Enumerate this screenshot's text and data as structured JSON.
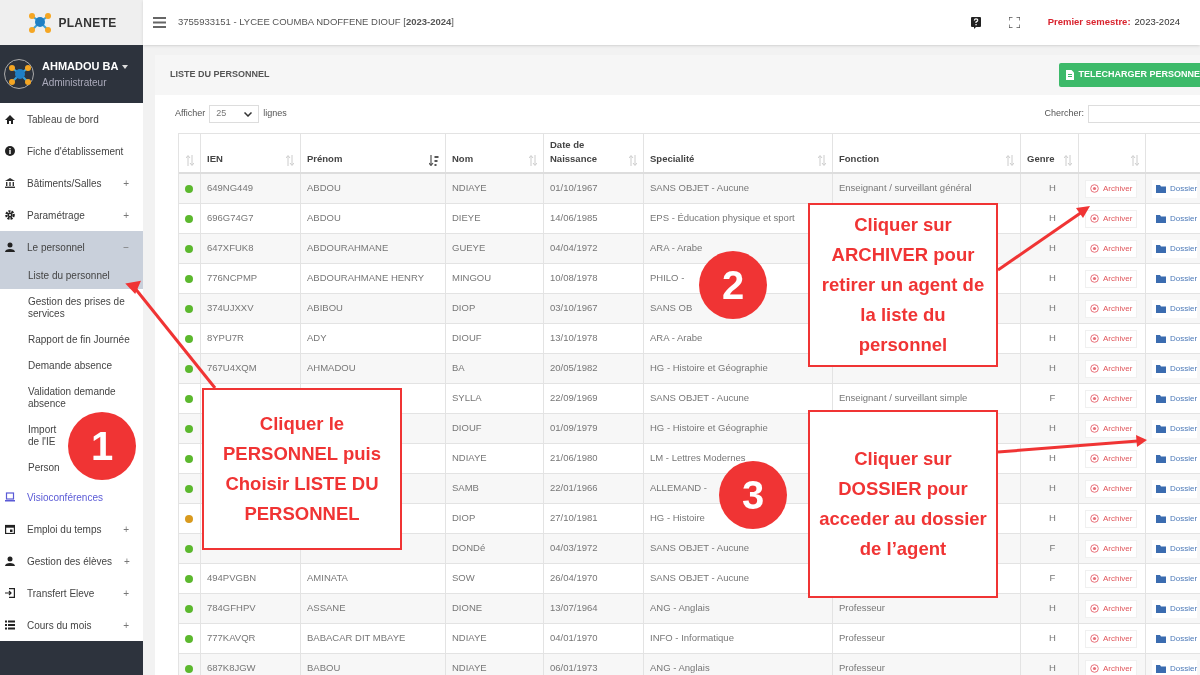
{
  "brand": {
    "name": "PLANETE"
  },
  "user": {
    "name": "AHMADOU BA",
    "role": "Administrateur"
  },
  "sidebar": {
    "items": [
      {
        "label": "Tableau de bord"
      },
      {
        "label": "Fiche d'établissement"
      },
      {
        "label": "Bâtiments/Salles",
        "toggle": "+"
      },
      {
        "label": "Paramétrage",
        "toggle": "+"
      },
      {
        "label": "Le personnel",
        "toggle": "−",
        "expanded": true,
        "children": [
          {
            "label": "Liste du personnel",
            "selected": true
          },
          {
            "label": "Gestion des prises de services",
            "selected": false
          },
          {
            "label": "Rapport de fin Journée",
            "selected": false
          },
          {
            "label": "Demande absence",
            "selected": false
          },
          {
            "label": "Validation demande absence",
            "selected": false
          },
          {
            "label": "Import de l'IE",
            "selected": false
          },
          {
            "label": "Person",
            "selected": false
          }
        ]
      },
      {
        "label": "Visioconférences",
        "kind": "link"
      },
      {
        "label": "Emploi du temps",
        "toggle": "+"
      },
      {
        "label": "Gestion des élèves",
        "toggle": "+"
      },
      {
        "label": "Transfert Eleve",
        "toggle": "+"
      },
      {
        "label": "Cours du mois",
        "toggle": "+"
      }
    ]
  },
  "header": {
    "title": "3755933151 - LYCEE COUMBA NDOFFENE DIOUF [**2023-2024**]",
    "semester_label": "Premier semestre:",
    "semester_value": "2023-2024"
  },
  "panel": {
    "title": "LISTE DU PERSONNEL",
    "download_button": "TELECHARGER PERSONNE",
    "show_label": "Afficher",
    "page_size": "25",
    "rows_label": "lignes",
    "search_label": "Chercher:"
  },
  "table": {
    "columns": [
      {
        "sorted": false
      },
      {
        "label": "IEN",
        "sorted": false
      },
      {
        "label": "Prénom",
        "sorted": true
      },
      {
        "label": "Nom",
        "sorted": false
      },
      {
        "label": "Date de Naissance",
        "sorted": false
      },
      {
        "label": "Specialité",
        "sorted": false
      },
      {
        "label": "Fonction",
        "sorted": false
      },
      {
        "label": "Genre",
        "sorted": false
      },
      {
        "sorted": false
      }
    ],
    "rows": [
      {
        "color": "#5cb82e",
        "ien": "649NG449",
        "prenom": "ABDOU",
        "nom": "NDIAYE",
        "date": "01/10/1967",
        "specialite": "SANS OBJET - Aucune",
        "fonction": "Enseignant / surveillant général",
        "genre": "H",
        "archive": "Archiver",
        "dossier": "Dossier"
      },
      {
        "color": "#5cb82e",
        "ien": "696G74G7",
        "prenom": "ABDOU",
        "nom": "DIEYE",
        "date": "14/06/1985",
        "specialite": "EPS - Éducation physique et sport",
        "genre": "H",
        "archive": "Archiver",
        "dossier": "Dossier"
      },
      {
        "color": "#5cb82e",
        "ien": "647XFUK8",
        "prenom": "ABDOURAHMANE",
        "nom": "GUEYE",
        "date": "04/04/1972",
        "specialite": "ARA - Arabe",
        "genre": "H",
        "archive": "Archiver",
        "dossier": "Dossier"
      },
      {
        "color": "#5cb82e",
        "ien": "776NCPMP",
        "prenom": "ABDOURAHMANE HENRY",
        "nom": "MINGOU",
        "date": "10/08/1978",
        "specialite": "PHILO -",
        "genre": "H",
        "archive": "Archiver",
        "dossier": "Dossier"
      },
      {
        "color": "#5cb82e",
        "ien": "374UJXXV",
        "prenom": "ABIBOU",
        "nom": "DIOP",
        "date": "03/10/1967",
        "specialite": "SANS OB",
        "genre": "H",
        "archive": "Archiver",
        "dossier": "Dossier"
      },
      {
        "color": "#5cb82e",
        "ien": "8YPU7R",
        "prenom": "ADY",
        "nom": "DIOUF",
        "date": "13/10/1978",
        "specialite": "ARA - Arabe",
        "genre": "H",
        "archive": "Archiver",
        "dossier": "Dossier"
      },
      {
        "color": "#5cb82e",
        "ien": "767U4XQM",
        "prenom": "AHMADOU",
        "nom": "BA",
        "date": "20/05/1982",
        "specialite": "HG - Histoire et Géographie",
        "genre": "H",
        "archive": "Archiver",
        "dossier": "Dossier"
      },
      {
        "color": "#5cb82e",
        "nom": "SYLLA",
        "date": "22/09/1969",
        "specialite": "SANS OBJET - Aucune",
        "fonction": "Enseignant / surveillant simple",
        "genre": "F",
        "archive": "Archiver",
        "dossier": "Dossier"
      },
      {
        "color": "#5cb82e",
        "nom": "DIOUF",
        "date": "01/09/1979",
        "specialite": "HG - Histoire et Géographie",
        "genre": "H",
        "archive": "Archiver",
        "dossier": "Dossier"
      },
      {
        "color": "#5cb82e",
        "nom": "NDIAYE",
        "date": "21/06/1980",
        "specialite": "LM - Lettres Modernes",
        "genre": "H",
        "archive": "Archiver",
        "dossier": "Dossier"
      },
      {
        "color": "#5cb82e",
        "nom": "SAMB",
        "date": "22/01/1966",
        "specialite": "ALLEMAND -",
        "genre": "H",
        "archive": "Archiver",
        "dossier": "Dossier"
      },
      {
        "color": "#d99a1e",
        "nom": "DIOP",
        "date": "27/10/1981",
        "specialite": "HG - Histoire",
        "genre": "H",
        "archive": "Archiver",
        "dossier": "Dossier"
      },
      {
        "color": "#5cb82e",
        "nom": "DONDé",
        "date": "04/03/1972",
        "specialite": "SANS OBJET - Aucune",
        "genre": "F",
        "archive": "Archiver",
        "dossier": "Dossier"
      },
      {
        "color": "#5cb82e",
        "ien": "494PVGBN",
        "prenom": "AMINATA",
        "nom": "SOW",
        "date": "26/04/1970",
        "specialite": "SANS OBJET - Aucune",
        "genre": "F",
        "archive": "Archiver",
        "dossier": "Dossier"
      },
      {
        "color": "#5cb82e",
        "ien": "784GFHPV",
        "prenom": "ASSANE",
        "nom": "DIONE",
        "date": "13/07/1964",
        "specialite": "ANG - Anglais",
        "fonction": "Professeur",
        "genre": "H",
        "archive": "Archiver",
        "dossier": "Dossier"
      },
      {
        "color": "#5cb82e",
        "ien": "777KAVQR",
        "prenom": "BABACAR DIT MBAYE",
        "nom": "NDIAYE",
        "date": "04/01/1970",
        "specialite": "INFO - Informatique",
        "fonction": "Professeur",
        "genre": "H",
        "archive": "Archiver",
        "dossier": "Dossier"
      },
      {
        "color": "#5cb82e",
        "ien": "687K8JGW",
        "prenom": "BABOU",
        "nom": "NDIAYE",
        "date": "06/01/1973",
        "specialite": "ANG - Anglais",
        "fonction": "Professeur",
        "genre": "H",
        "archive": "Archiver",
        "dossier": "Dossier"
      }
    ]
  },
  "annotations": {
    "steps": [
      "1",
      "2",
      "3"
    ],
    "notes": [
      "Cliquer le PERSONNEL puis Choisir LISTE DU PERSONNEL",
      "Cliquer  sur ARCHIVER pour retirer un agent de la liste du personnel",
      "Cliquer  sur DOSSIER pour acceder au dossier de l’agent"
    ]
  }
}
